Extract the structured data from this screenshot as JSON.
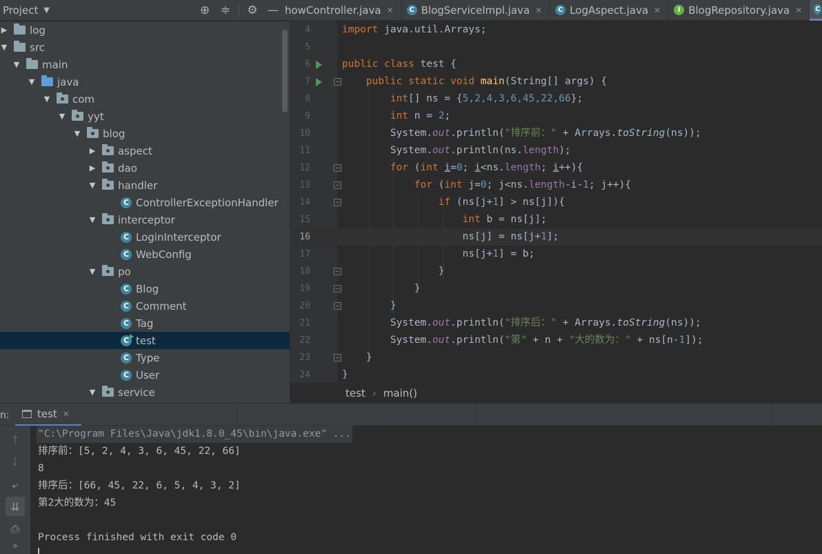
{
  "toolbar": {
    "project_label": "Project",
    "tabs": [
      {
        "label": "howController.java",
        "icon": "class-icon"
      },
      {
        "label": "BlogServiceImpl.java",
        "icon": "class-icon"
      },
      {
        "label": "LogAspect.java",
        "icon": "class-icon"
      },
      {
        "label": "BlogRepository.java",
        "icon": "interface-icon"
      }
    ]
  },
  "tree": {
    "items": [
      {
        "label": "log"
      },
      {
        "label": "src"
      },
      {
        "label": "main"
      },
      {
        "label": "java"
      },
      {
        "label": "com"
      },
      {
        "label": "yyt"
      },
      {
        "label": "blog"
      },
      {
        "label": "aspect"
      },
      {
        "label": "dao"
      },
      {
        "label": "handler"
      },
      {
        "label": "ControllerExceptionHandler"
      },
      {
        "label": "interceptor"
      },
      {
        "label": "LoginInterceptor"
      },
      {
        "label": "WebConfig"
      },
      {
        "label": "po"
      },
      {
        "label": "Blog"
      },
      {
        "label": "Comment"
      },
      {
        "label": "Tag"
      },
      {
        "label": "test"
      },
      {
        "label": "Type"
      },
      {
        "label": "User"
      },
      {
        "label": "service"
      }
    ]
  },
  "editor": {
    "line_numbers": [
      "4",
      "5",
      "6",
      "7",
      "8",
      "9",
      "10",
      "11",
      "12",
      "13",
      "14",
      "15",
      "16",
      "17",
      "18",
      "19",
      "20",
      "21",
      "22",
      "23",
      "24"
    ],
    "current_line": "16",
    "code": {
      "l4_import": "import",
      "l4_rest": " java.util.Arrays;",
      "l6_public": "public",
      "l6_class": " class",
      "l6_name": " test {",
      "l7_public": "public",
      "l7_static": " static",
      "l7_void": " void",
      "l7_main": "main",
      "l7_args": "(String[] args) {",
      "l8_int": "int",
      "l8_decl": "[] ns = {",
      "l8_nums": "5,2,4,3,6,45,22,66",
      "l8_end": "};",
      "l9_int": "int",
      "l9_decl": " n = ",
      "l9_num": "2",
      "l9_end": ";",
      "l10_sys": "System.",
      "l10_out": "out",
      "l10_println": ".println(",
      "l10_str": "\"排序前：\"",
      "l10_plus": " + Arrays.",
      "l10_tostring": "toString",
      "l10_end": "(ns));",
      "l11_sys": "System.",
      "l11_out": "out",
      "l11_println": ".println(ns.",
      "l11_length": "length",
      "l11_end": ");",
      "l12_for": "for",
      "l12_open": " (",
      "l12_int": "int",
      "l12_sp": " ",
      "l12_i": "i",
      "l12_init": "=",
      "l12_zero": "0",
      "l12_semi": "; ",
      "l12_i2": "i",
      "l12_cond": "<ns.",
      "l12_len": "length",
      "l12_semi2": "; ",
      "l12_i3": "i",
      "l12_end": "++){",
      "l13_for": "for",
      "l13_open": " (",
      "l13_int": "int",
      "l13_init": " j=",
      "l13_zero": "0",
      "l13_cond": "; j<ns.",
      "l13_len": "length",
      "l13_minus": "-i-",
      "l13_one": "1",
      "l13_end": "; j++){",
      "l14_if": "if",
      "l14_a": " (ns[j+",
      "l14_one": "1",
      "l14_b": "] > ns[j]){",
      "l15_int": "int",
      "l15_rest": " b = ns[j];",
      "l16_a": "ns[j] = ns[j+",
      "l16_one": "1",
      "l16_end": "];",
      "l17_a": "ns[j+",
      "l17_one": "1",
      "l17_end": "] = b;",
      "l18": "}",
      "l19": "}",
      "l20": "}",
      "l21_sys": "System.",
      "l21_out": "out",
      "l21_println": ".println(",
      "l21_str": "\"排序后：\"",
      "l21_plus": " + Arrays.",
      "l21_tostring": "toString",
      "l21_end": "(ns));",
      "l22_sys": "System.",
      "l22_out": "out",
      "l22_println": ".println(",
      "l22_s1": "\"第\"",
      "l22_mid": " + n + ",
      "l22_s2": "\"大的数为：\"",
      "l22_end": " + ns[n-",
      "l22_one": "1",
      "l22_close": "]);",
      "l23": "}",
      "l24": "}"
    }
  },
  "breadcrumb": {
    "class": "test",
    "method": "main()"
  },
  "run": {
    "label": "n:",
    "tab": "test",
    "lines": [
      "\"C:\\Program Files\\Java\\jdk1.8.0_45\\bin\\java.exe\" ...",
      "排序前：[5, 2, 4, 3, 6, 45, 22, 66]",
      "8",
      "排序后：[66, 45, 22, 6, 5, 4, 3, 2]",
      "第2大的数为：45",
      "",
      "Process finished with exit code 0"
    ]
  },
  "colors": {
    "keyword": "#cc7832",
    "number": "#6897bb",
    "string": "#6a8759",
    "method": "#ffc66d",
    "field": "#9876aa",
    "selection": "#0d293e"
  }
}
